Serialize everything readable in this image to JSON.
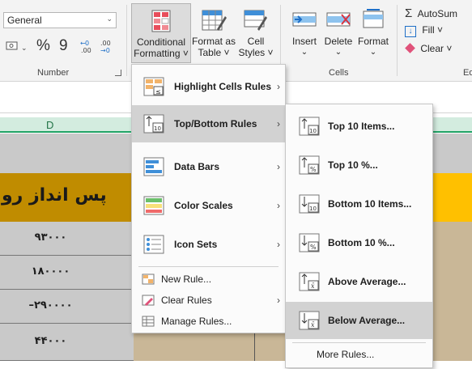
{
  "ribbon": {
    "number_format": "General",
    "number_group_label": "Number",
    "cells_group_label": "Cells",
    "editing_group_label_partial": "Ed",
    "buttons": {
      "conditional_formatting": [
        "Conditional",
        "Formatting ˅"
      ],
      "format_as_table": [
        "Format as",
        "Table ˅"
      ],
      "cell_styles": [
        "Cell",
        "Styles ˅"
      ],
      "insert": "Insert",
      "delete": "Delete",
      "format": "Format",
      "autosum": "AutoSum",
      "fill": "Fill ˅",
      "clear": "Clear ˅"
    },
    "number_symbols": {
      "percent": "%",
      "comma": "9",
      "inc_decimal": "←0\n.00",
      "dec_decimal": ".00\n→0"
    }
  },
  "sheet": {
    "column_header": "D",
    "header_text": "پس انداز رو",
    "values": [
      "۹۳۰۰۰",
      "۱۸۰۰۰۰",
      "–۲۹۰۰۰۰",
      "۴۴۰۰۰"
    ]
  },
  "cf_menu": {
    "items": [
      {
        "label": "Highlight Cells Rules",
        "underline": "H"
      },
      {
        "label": "Top/Bottom Rules",
        "underline": "T"
      },
      {
        "label": "Data Bars",
        "underline": "D"
      },
      {
        "label": "Color Scales",
        "underline": "S"
      },
      {
        "label": "Icon Sets",
        "underline": "I"
      }
    ],
    "small_items": [
      {
        "label": "New Rule..."
      },
      {
        "label": "Clear Rules"
      },
      {
        "label": "Manage Rules..."
      }
    ]
  },
  "topbottom_menu": {
    "items": [
      {
        "label": "Top 10 Items...",
        "icon_text": "10"
      },
      {
        "label": "Top 10 %...",
        "icon_text": "%"
      },
      {
        "label": "Bottom 10 Items...",
        "icon_text": "10"
      },
      {
        "label": "Bottom 10 %...",
        "icon_text": "%"
      },
      {
        "label": "Above Average...",
        "icon_text": "x̄"
      },
      {
        "label": "Below Average...",
        "icon_text": "x̄"
      }
    ],
    "more_rules": "More Rules..."
  }
}
